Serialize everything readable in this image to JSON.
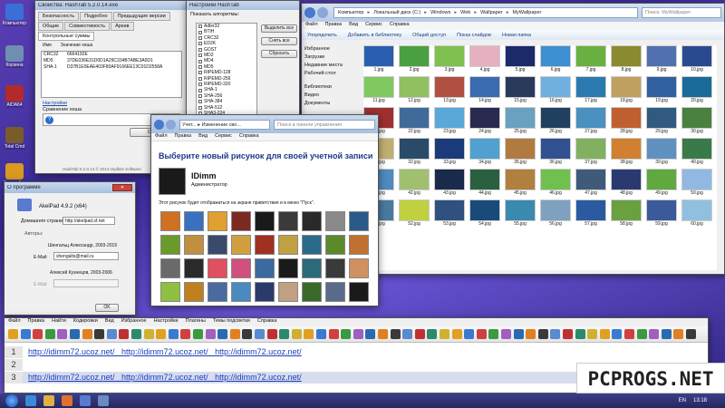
{
  "desktop": {
    "icons": [
      {
        "label": "Компьютер",
        "color": "#3a6fd8"
      },
      {
        "label": "Корзина",
        "color": "#6f8fb0"
      },
      {
        "label": "AIDA64",
        "color": "#b22a2a"
      },
      {
        "label": "Total Cmd",
        "color": "#7a5b2a"
      },
      {
        "label": "Настройка",
        "color": "#d89a20"
      }
    ]
  },
  "hashtab": {
    "title": "Свойства: HashTab 5.2.0.14.exe",
    "tabs": [
      "Безопасность",
      "Подробно",
      "Предыдущие версии",
      "Общие",
      "Совместимость",
      "Архив",
      "Контрольные суммы"
    ],
    "col_name": "Имя",
    "col_value": "Значение хеша",
    "rows": [
      {
        "name": "CRC32",
        "value": "6664192E"
      },
      {
        "name": "MD5",
        "value": "37DE036E31D0D1A29C334B7ABE3A0D1"
      },
      {
        "name": "SHA-1",
        "value": "D37B1E0EAE403F80AF9166EE13C01D2558A"
      }
    ],
    "settings_link": "Настройки",
    "compare_label": "Сравнение хеша",
    "compare_button": "Сравнить",
    "footer": "HashTab 5.2.0.14 © 2014 Implbits Software"
  },
  "hashsettings": {
    "title": "Настройки HashTab",
    "show_label": "Показать алгоритмы:",
    "algorithms": [
      "Adler32",
      "BTIH",
      "CRC32",
      "ED2K",
      "GOST",
      "MD2",
      "MD4",
      "MD5",
      "RIPEMD-128",
      "RIPEMD-256",
      "RIPEMD-320",
      "SHA-1",
      "SHA-256",
      "SHA-384",
      "SHA-512",
      "SHA3-224",
      "SHA3-256",
      "SHA3-384"
    ],
    "select_all": "Выделить все",
    "clear_all": "Снять все",
    "reset": "Сбросить"
  },
  "about": {
    "title": "О программе",
    "app_name": "AkelPad 4.9.2 (x64)",
    "homepage_label": "Домашняя страница:",
    "homepage_value": "http://akelpad.sf.net",
    "authors_label": "Авторы:",
    "author1": "Шенгальц Александр, 2003-2015",
    "email_label": "E-Mail:",
    "email1": "shengalts@mail.ru",
    "author2": "Алексей Кузнецов, 2003-2006",
    "email2_label": "E-Mail:",
    "ok_button": "OK"
  },
  "explorer": {
    "breadcrumb": [
      "Компьютер",
      "Локальный диск (C:)",
      "Windows",
      "Web",
      "Wallpaper",
      "MyWallpaper"
    ],
    "search_placeholder": "Поиск: MyWallpaper",
    "menu": [
      "Файл",
      "Правка",
      "Вид",
      "Сервис",
      "Справка"
    ],
    "toolbar": [
      "Упорядочить",
      "Добавить в библиотеку",
      "Общий доступ",
      "Показ слайдов",
      "Новая папка"
    ],
    "nav": [
      "Избранное",
      "Загрузки",
      "Недавние места",
      "Рабочий стол",
      "Библиотеки",
      "Видео",
      "Документы"
    ],
    "files": [
      "1.jpg",
      "2.jpg",
      "3.jpg",
      "4.jpg",
      "5.jpg",
      "6.jpg",
      "7.jpg",
      "8.jpg",
      "9.jpg",
      "10.jpg",
      "11.jpg",
      "12.jpg",
      "13.jpg",
      "14.jpg",
      "15.jpg",
      "16.jpg",
      "17.jpg",
      "18.jpg",
      "19.jpg",
      "20.jpg",
      "21.jpg",
      "22.jpg",
      "23.jpg",
      "24.jpg",
      "25.jpg",
      "26.jpg",
      "27.jpg",
      "28.jpg",
      "29.jpg",
      "30.jpg",
      "31.jpg",
      "32.jpg",
      "33.jpg",
      "34.jpg",
      "35.jpg",
      "36.jpg",
      "37.jpg",
      "38.jpg",
      "39.jpg",
      "40.jpg",
      "41.jpg",
      "42.jpg",
      "43.jpg",
      "44.jpg",
      "45.jpg",
      "46.jpg",
      "47.jpg",
      "48.jpg",
      "49.jpg",
      "50.jpg",
      "51.jpg",
      "52.jpg",
      "53.jpg",
      "54.jpg",
      "55.jpg",
      "56.jpg",
      "57.jpg",
      "58.jpg",
      "59.jpg",
      "60.jpg"
    ],
    "colors": [
      "#2a5fb0",
      "#4aa040",
      "#7fc050",
      "#e6b0c0",
      "#1a2a6a",
      "#3c8fd0",
      "#6ab040",
      "#8a8a30",
      "#5070b0",
      "#2a4a90",
      "#80c860",
      "#90c060",
      "#b05040",
      "#3a6ab0",
      "#2a3a5a",
      "#70b0e0",
      "#2a7ab0",
      "#c0a060",
      "#3060a0",
      "#1a6a9a",
      "#a03030",
      "#406a9a",
      "#5aa8d8",
      "#2a2a50",
      "#6aa0c0",
      "#204060",
      "#4a90c0",
      "#c06030",
      "#305a80",
      "#4a8040",
      "#c0b070",
      "#2a4a6a",
      "#1a3a7a",
      "#50a0d0",
      "#b07a40",
      "#305090",
      "#80b060",
      "#d08030",
      "#6090c0",
      "#3a7a4a",
      "#508ac0",
      "#a0c070",
      "#1a2a4a",
      "#2a6040",
      "#b08040",
      "#70c050",
      "#405a7a",
      "#2a3a70",
      "#60a840",
      "#90b8e0",
      "#4a7aa0",
      "#c0d040",
      "#305080",
      "#1a4a7a",
      "#3a8ab0",
      "#80a0c0",
      "#2a5aa0",
      "#6aa040",
      "#3a5a9a",
      "#90c0e0"
    ]
  },
  "account": {
    "title": "Изменение сво...",
    "breadcrumb": "Учет...",
    "search_placeholder": "Поиск в панели управления",
    "menu": [
      "Файл",
      "Правка",
      "Вид",
      "Сервис",
      "Справка"
    ],
    "heading": "Выберите новый рисунок для своей учетной записи",
    "user_name": "IDimm",
    "user_role": "Администратор",
    "description": "Этот рисунок будет отображаться на экране приветствия и в меню \"Пуск\".",
    "pic_colors": [
      "#d07020",
      "#3a70c0",
      "#e0a030",
      "#7a2a20",
      "#1a1a1a",
      "#3a3a3a",
      "#2a2a2a",
      "#8a8a8a",
      "#2a5a8a",
      "#6a9a2a",
      "#c09040",
      "#3a4a6a",
      "#d0a040",
      "#a03020",
      "#c0a040",
      "#2a6a8a",
      "#5a8a2a",
      "#c07030",
      "#6a6a6a",
      "#2a2a2a",
      "#e05060",
      "#d05080",
      "#3a6aa0",
      "#1a1a1a",
      "#2a6a7a",
      "#3a3a3a",
      "#d09060",
      "#90c040",
      "#c08020",
      "#4a6aa0",
      "#4a8ac0",
      "#2a3a6a",
      "#c0a080",
      "#3a6a2a",
      "#5a6a8a",
      "#1a1a1a"
    ]
  },
  "editor": {
    "menu": [
      "Файл",
      "Правка",
      "Найти",
      "Кодировки",
      "Вид",
      "Избранное",
      "Настройки",
      "Плагины",
      "Темы подсветки",
      "Справка"
    ],
    "lines": [
      {
        "num": "1",
        "text": "http://idimm72.ucoz.net/   http://idimm72.ucoz.net/   http://idimm72.ucoz.net/"
      },
      {
        "num": "2",
        "text": ""
      },
      {
        "num": "3",
        "text": "http://idimm72.ucoz.net/   http://idimm72.ucoz.net/   http://idimm72.ucoz.net/"
      }
    ],
    "toolbar_colors": [
      "#e0a020",
      "#3a7ad0",
      "#d04040",
      "#3a9a40",
      "#a060c0",
      "#2a6ab0",
      "#e08020",
      "#3a3a3a",
      "#5a8ad0",
      "#c03030",
      "#2a8a6a",
      "#d0b030"
    ]
  },
  "watermark": "PCPROGS.NET",
  "taskbar": {
    "lang": "EN",
    "time": "13:18"
  }
}
